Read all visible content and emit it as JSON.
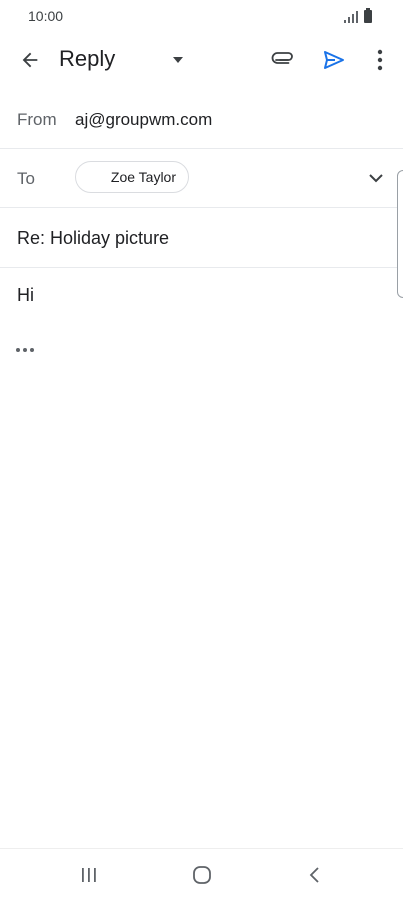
{
  "status_bar": {
    "time": "10:00",
    "signal_icon": "signal-bars-icon",
    "battery_icon": "battery-icon"
  },
  "toolbar": {
    "back_icon": "arrow-back-icon",
    "title": "Reply",
    "dropdown_icon": "caret-down-icon",
    "attach_icon": "paperclip-icon",
    "send_icon": "send-icon",
    "more_icon": "more-vertical-icon"
  },
  "compose": {
    "from_label": "From",
    "from_value": "aj@groupwm.com",
    "to_label": "To",
    "to_chip": "Zoe Taylor",
    "expand_icon": "chevron-down-icon",
    "subject": "Re: Holiday picture",
    "body": "Hi",
    "quoted_icon": "more-horizontal-icon"
  },
  "nav": {
    "recents_icon": "recents-icon",
    "home_icon": "home-icon",
    "back_icon": "nav-back-icon"
  },
  "colors": {
    "send": "#1a73e8",
    "icon": "#5f6368",
    "divider": "#e8eaed"
  }
}
